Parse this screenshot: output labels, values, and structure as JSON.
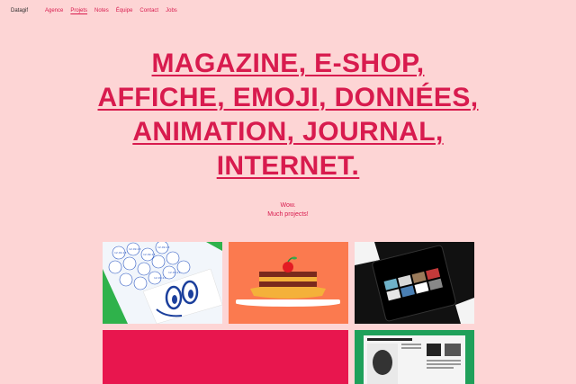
{
  "header": {
    "brand": "Datagif",
    "nav": [
      {
        "label": "Agence"
      },
      {
        "label": "Projets",
        "active": true
      },
      {
        "label": "Notes"
      },
      {
        "label": "Équipe"
      },
      {
        "label": "Contact"
      },
      {
        "label": "Jobs"
      }
    ]
  },
  "hero": {
    "lines": [
      "MAGAZINE, E-SHOP,",
      "AFFICHE, EMOJI, DONNÉES,",
      "ANIMATION, JOURNAL,",
      "INTERNET."
    ]
  },
  "tagline": {
    "line1": "Wow.",
    "line2": "Much projects!"
  },
  "projects": [
    {
      "name": "date-stickers-eyes"
    },
    {
      "name": "cake-illustration"
    },
    {
      "name": "dark-tablet-gallery"
    },
    {
      "name": "red-block"
    },
    {
      "name": "green-newspaper"
    }
  ],
  "colors": {
    "background": "#fdd5d5",
    "accent": "#d81b4e"
  }
}
